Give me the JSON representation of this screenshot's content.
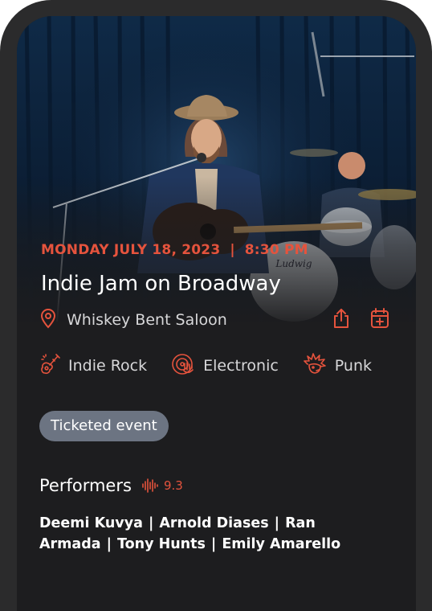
{
  "event": {
    "date": "MONDAY JULY 18, 2023",
    "date_separator": "|",
    "time": "8:30 PM",
    "title": "Indie Jam on Broadway",
    "venue": "Whiskey Bent Saloon"
  },
  "genres": [
    {
      "label": "Indie Rock",
      "icon": "guitar-icon"
    },
    {
      "label": "Electronic",
      "icon": "vinyl-hand-icon"
    },
    {
      "label": "Punk",
      "icon": "punk-icon"
    }
  ],
  "badge": {
    "label": "Ticketed event"
  },
  "performers": {
    "heading": "Performers",
    "score": "9.3",
    "names": [
      "Deemi Kuvya",
      "Arnold Diases",
      "Ran Armada",
      "Tony Hunts",
      "Emily Amarello"
    ],
    "separator": "|"
  },
  "colors": {
    "accent": "#e5533d",
    "background": "#1d1d1f",
    "frame": "#2b2b2c",
    "badge": "#6c7482",
    "text_muted": "#d7d7d9"
  },
  "icons": {
    "venue": "location-pin-icon",
    "share": "share-icon",
    "calendar": "add-to-calendar-icon",
    "score": "sound-wave-icon"
  }
}
